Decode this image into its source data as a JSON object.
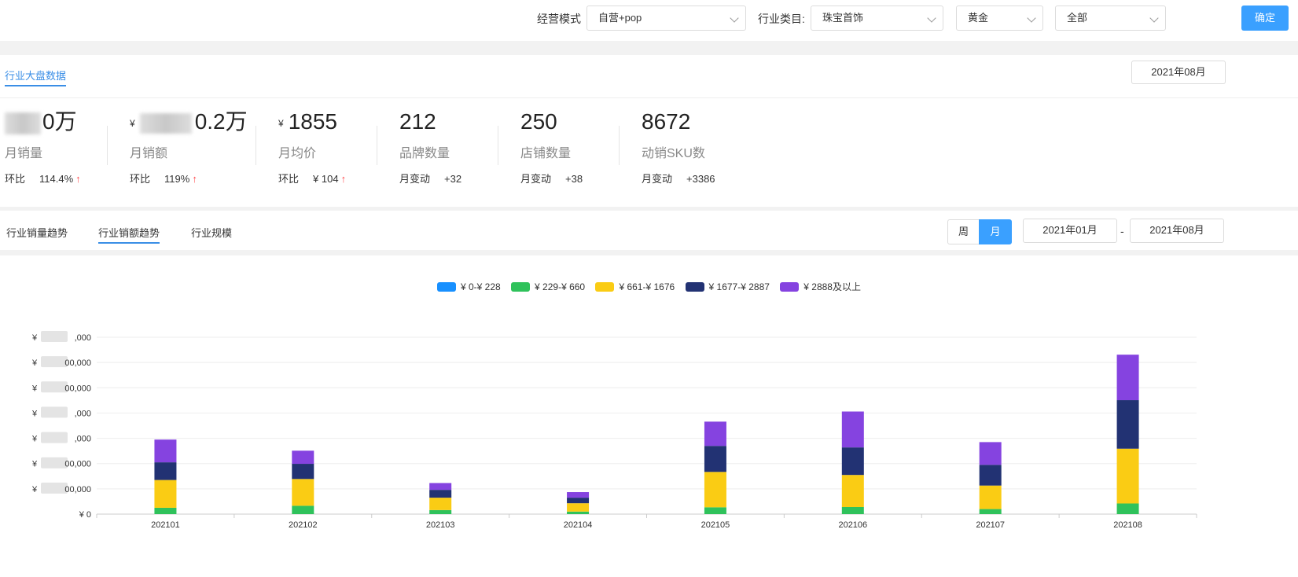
{
  "filters": {
    "mode_label": "经营模式",
    "mode_value": "自营+pop",
    "category_label": "行业类目:",
    "category_value": "珠宝首饰",
    "sub_value": "黄金",
    "third_value": "全部",
    "confirm_label": "确定"
  },
  "overview": {
    "tab_label": "行业大盘数据",
    "month": "2021年08月",
    "stats": [
      {
        "value": "0万",
        "name": "月销量",
        "sub_key": "环比",
        "sub_val": "114.4%",
        "arrow": "↑"
      },
      {
        "currency": "¥",
        "value": "0.2万",
        "name": "月销额",
        "sub_key": "环比",
        "sub_val": "119%",
        "arrow": "↑"
      },
      {
        "currency": "¥",
        "value": "1855",
        "name": "月均价",
        "sub_key": "环比",
        "sub_val": "¥ 104",
        "arrow": "↑"
      },
      {
        "value": "212",
        "name": "品牌数量",
        "sub_key": "月变动",
        "sub_val": "+32"
      },
      {
        "value": "250",
        "name": "店铺数量",
        "sub_key": "月变动",
        "sub_val": "+38"
      },
      {
        "value": "8672",
        "name": "动销SKU数",
        "sub_key": "月变动",
        "sub_val": "+3386"
      }
    ]
  },
  "trend_tabs": {
    "tab1": "行业销量趋势",
    "tab2": "行业销额趋势",
    "tab3": "行业规模",
    "week": "周",
    "month": "月",
    "start": "2021年01月",
    "dash": "-",
    "end": "2021年08月"
  },
  "colors": {
    "s1": "#1890ff",
    "s2": "#2fc25b",
    "s3": "#facc14",
    "s4": "#223273",
    "s5": "#8543e0"
  },
  "chart_data": {
    "type": "bar",
    "stacked": true,
    "categories": [
      "202101",
      "202102",
      "202103",
      "202104",
      "202105",
      "202106",
      "202107",
      "202108"
    ],
    "ytick_labels": [
      ",000",
      "00,000",
      "00,000",
      ",000",
      ",000",
      "00,000",
      "00,000",
      "¥ 0"
    ],
    "ytick_prefix": "¥",
    "ylim": [
      0,
      7
    ],
    "series": [
      {
        "name": "¥ 0-¥ 228",
        "values": [
          0.0,
          0.0,
          0.0,
          0.0,
          0.0,
          0.0,
          0.0,
          0.0
        ]
      },
      {
        "name": "¥ 229-¥ 660",
        "values": [
          0.25,
          0.33,
          0.16,
          0.1,
          0.27,
          0.28,
          0.2,
          0.42
        ]
      },
      {
        "name": "¥ 661-¥ 1676",
        "values": [
          1.1,
          1.06,
          0.49,
          0.33,
          1.4,
          1.27,
          0.93,
          2.17
        ]
      },
      {
        "name": "¥ 1677-¥ 2887",
        "values": [
          0.7,
          0.6,
          0.31,
          0.22,
          1.03,
          1.09,
          0.82,
          1.92
        ]
      },
      {
        "name": "¥ 2888及以上",
        "values": [
          0.9,
          0.52,
          0.27,
          0.22,
          0.96,
          1.42,
          0.9,
          1.8
        ]
      }
    ],
    "grid": true,
    "legend_position": "top-center"
  }
}
